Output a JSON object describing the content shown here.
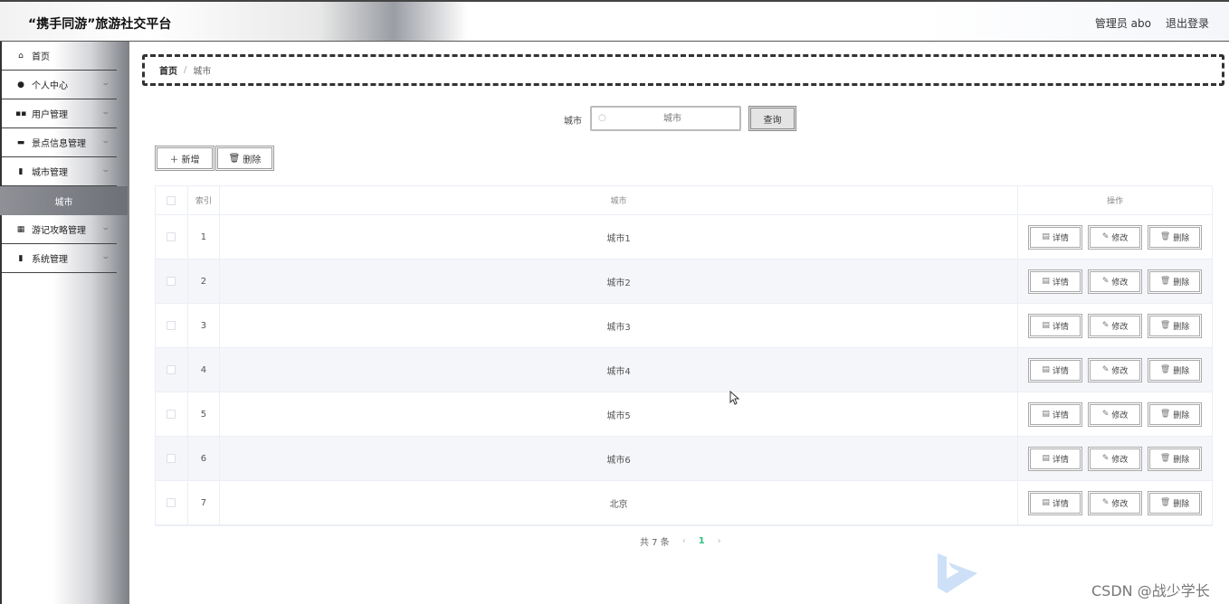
{
  "header": {
    "title": "“携手同游”旅游社交平台",
    "user": "管理员 abo",
    "logout": "退出登录"
  },
  "sidebar": {
    "items": [
      {
        "label": "首页",
        "icon": "home-icon",
        "glyph": "⌂",
        "has_children": false
      },
      {
        "label": "个人中心",
        "icon": "person-icon",
        "glyph": "●",
        "has_children": true
      },
      {
        "label": "用户管理",
        "icon": "grid-icon",
        "glyph": "▪",
        "has_children": true
      },
      {
        "label": "景点信息管理",
        "icon": "briefcase-icon",
        "glyph": "▬",
        "has_children": true
      },
      {
        "label": "城市管理",
        "icon": "database-icon",
        "glyph": "▮",
        "has_children": true
      },
      {
        "label": "游记攻略管理",
        "icon": "apps-icon",
        "glyph": "▦",
        "has_children": true
      },
      {
        "label": "系统管理",
        "icon": "clipboard-icon",
        "glyph": "▮",
        "has_children": true
      }
    ],
    "active_sub": "城市"
  },
  "breadcrumb": {
    "home": "首页",
    "separator": "/",
    "current": "城市"
  },
  "search": {
    "label": "城市",
    "placeholder": "城市",
    "button": "查询"
  },
  "toolbar": {
    "add": "新增",
    "delete": "删除"
  },
  "table": {
    "headers": {
      "index": "索引",
      "city": "城市",
      "ops": "操作"
    },
    "rows": [
      {
        "index": "1",
        "city": "城市1"
      },
      {
        "index": "2",
        "city": "城市2"
      },
      {
        "index": "3",
        "city": "城市3"
      },
      {
        "index": "4",
        "city": "城市4"
      },
      {
        "index": "5",
        "city": "城市5"
      },
      {
        "index": "6",
        "city": "城市6"
      },
      {
        "index": "7",
        "city": "北京"
      }
    ],
    "row_actions": {
      "detail": "详情",
      "edit": "修改",
      "delete": "删除"
    }
  },
  "pagination": {
    "total": "共 7 条",
    "current_page": "1",
    "prev": "‹",
    "next": "›"
  },
  "watermark": "CSDN @战少学长",
  "colors": {
    "accent": "#2ec27e",
    "stripe": "#f5f6fa",
    "sidebar_active": "#7a7d83"
  }
}
